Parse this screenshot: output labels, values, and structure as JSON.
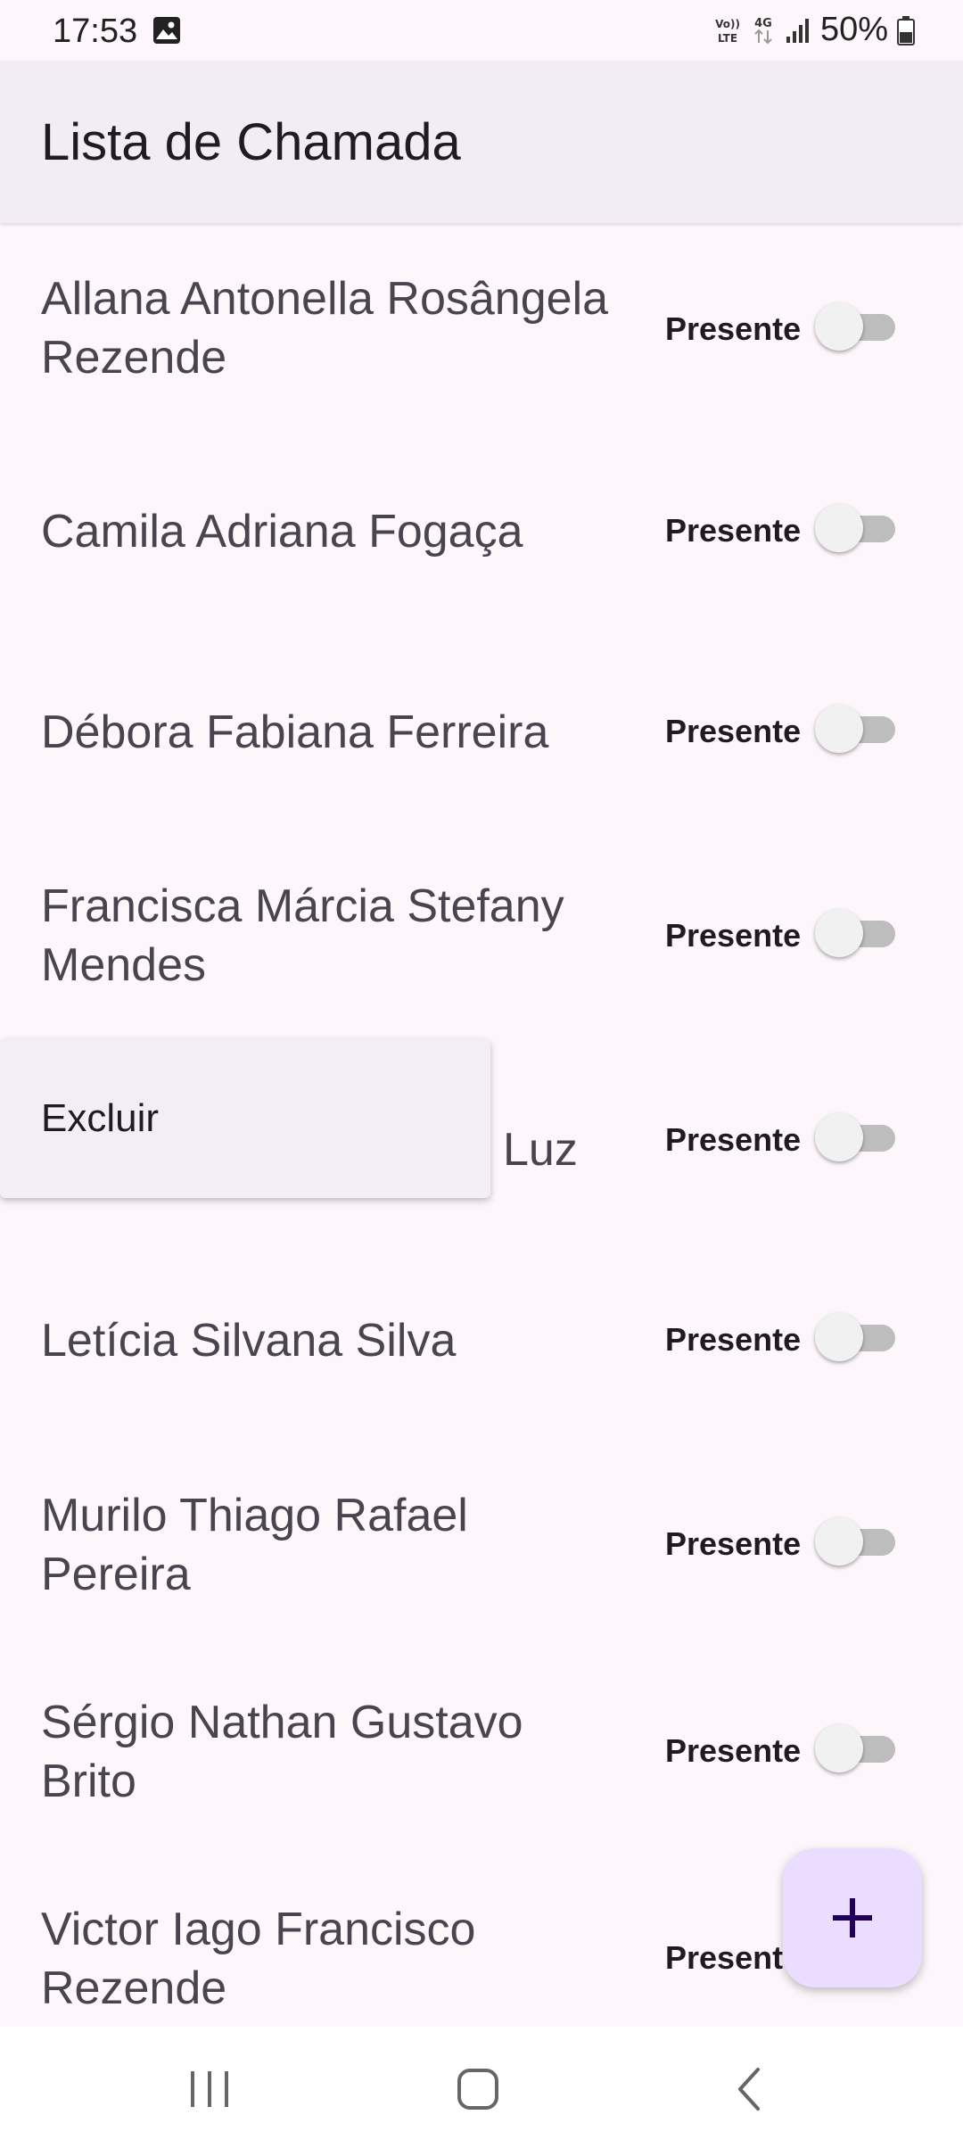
{
  "status_bar": {
    "time": "17:53",
    "battery": "50%",
    "icons": [
      "gallery-icon",
      "volte-icon",
      "4g-icon",
      "signal-icon",
      "battery-icon"
    ]
  },
  "app_bar": {
    "title": "Lista de Chamada"
  },
  "students": [
    {
      "name": "Allana Antonella Rosângela Rezende",
      "toggle_label": "Presente",
      "present": false
    },
    {
      "name": "Camila Adriana Fogaça",
      "toggle_label": "Presente",
      "present": false
    },
    {
      "name": "Débora Fabiana Ferreira",
      "toggle_label": "Presente",
      "present": false
    },
    {
      "name": "Francisca Márcia Stefany Mendes",
      "toggle_label": "Presente",
      "present": false
    },
    {
      "name": "Luz",
      "toggle_label": "Presente",
      "present": false
    },
    {
      "name": "Letícia Silvana Silva",
      "toggle_label": "Presente",
      "present": false
    },
    {
      "name": "Murilo Thiago Rafael Pereira",
      "toggle_label": "Presente",
      "present": false
    },
    {
      "name": "Sérgio Nathan Gustavo Brito",
      "toggle_label": "Presente",
      "present": false
    },
    {
      "name": "Victor Iago Francisco Rezende",
      "toggle_label": "Present",
      "present": false
    }
  ],
  "context_menu": {
    "items": [
      {
        "label": "Excluir"
      }
    ]
  },
  "fab": {
    "icon": "plus-icon"
  },
  "nav_bar": {
    "icons": [
      "recent-apps-icon",
      "home-icon",
      "back-icon"
    ]
  },
  "colors": {
    "background": "#fdf7fc",
    "app_bar": "#f2edf4",
    "fab": "#eaddff",
    "fab_icon": "#21005d",
    "switch_track_off": "#bdbdbd"
  }
}
